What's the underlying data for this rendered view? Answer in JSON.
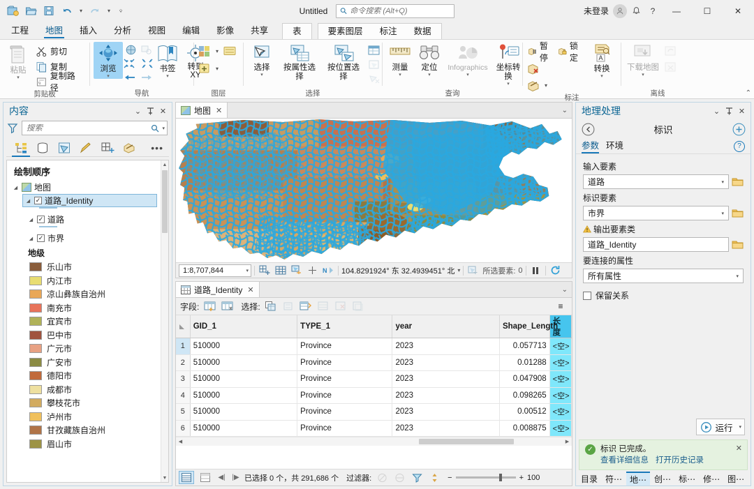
{
  "titlebar": {
    "doc_title": "Untitled",
    "search_placeholder": "命令搜索 (Alt+Q)",
    "account_status": "未登录",
    "quick_access": [
      "new-project-icon",
      "open-project-icon",
      "save-project-icon",
      "undo-icon",
      "redo-icon",
      "customize-qat-icon"
    ],
    "window_buttons": {
      "minimize": "—",
      "maximize": "☐",
      "close": "✕"
    },
    "help": "?"
  },
  "ribbon_tabs": {
    "items": [
      "工程",
      "地图",
      "插入",
      "分析",
      "视图",
      "编辑",
      "影像",
      "共享"
    ],
    "active": "地图",
    "contextual_single": [
      "表"
    ],
    "contextual_group": [
      "要素图层",
      "标注",
      "数据"
    ]
  },
  "ribbon": {
    "groups": [
      {
        "label": "剪贴板",
        "paste": "粘贴",
        "items": [
          "剪切",
          "复制",
          "复制路径"
        ]
      },
      {
        "label": "导航",
        "explore": "浏览",
        "bookmarks": "书签",
        "goto_xy_line1": "转到",
        "goto_xy_line2": "XY"
      },
      {
        "label": "图层"
      },
      {
        "label": "选择",
        "items": [
          "选择",
          "按属性选择",
          "按位置选择"
        ]
      },
      {
        "label": "查询",
        "items": [
          "测量",
          "定位",
          "Infographics",
          "坐标转换"
        ]
      },
      {
        "label": "标注",
        "pause": "暂停",
        "lock": "锁定",
        "convert": "转换"
      },
      {
        "label": "离线",
        "download_map": "下载地图"
      }
    ]
  },
  "contents_pane": {
    "title": "内容",
    "search_placeholder": "搜索",
    "draw_order_heading": "绘制顺序",
    "tabs": [
      "list-by-drawing-order-icon",
      "list-by-data-source-icon",
      "list-by-selection-icon",
      "list-by-editing-icon",
      "list-by-snapping-icon",
      "list-by-labeling-icon"
    ],
    "more": "•••",
    "tree": {
      "map_node": "地图",
      "layers": [
        {
          "name": "道路_Identity",
          "checked": true,
          "selected": true
        },
        {
          "name": "道路",
          "checked": true,
          "selected": false
        },
        {
          "name": "市界",
          "checked": true,
          "selected": false
        }
      ]
    },
    "legend": {
      "field": "地级",
      "items": [
        {
          "label": "乐山市",
          "color": "#8a5d3b"
        },
        {
          "label": "内江市",
          "color": "#e8dd72"
        },
        {
          "label": "凉山彝族自治州",
          "color": "#e9a757"
        },
        {
          "label": "南充市",
          "color": "#e8735a"
        },
        {
          "label": "宜宾市",
          "color": "#b0b258"
        },
        {
          "label": "巴中市",
          "color": "#a0533f"
        },
        {
          "label": "广元市",
          "color": "#e8a183"
        },
        {
          "label": "广安市",
          "color": "#8b8b43"
        },
        {
          "label": "德阳市",
          "color": "#c16a3b"
        },
        {
          "label": "成都市",
          "color": "#eee0a0"
        },
        {
          "label": "攀枝花市",
          "color": "#d2ab60"
        },
        {
          "label": "泸州市",
          "color": "#f0c05c"
        },
        {
          "label": "甘孜藏族自治州",
          "color": "#b07448"
        },
        {
          "label": "眉山市",
          "color": "#9d9345"
        }
      ]
    }
  },
  "map_view": {
    "tab_label": "地图",
    "close": "✕",
    "scale": "1:8,707,844",
    "coordinates": "104.8291924° 东  32.4939451° 北",
    "selected_features_label": "所选要素:",
    "selected_features_count": "0",
    "status_icons": [
      "add-grid-icon",
      "grid-icon",
      "selection-tool-icon",
      "crosshair-icon",
      "north-arrow-icon",
      "selected-features-icon",
      "pause-drawing-icon",
      "refresh-icon"
    ]
  },
  "attribute_table": {
    "tab_label": "道路_Identity",
    "close": "✕",
    "toolbar": {
      "fields_label": "字段:",
      "select_label": "选择:",
      "icons": [
        "add-field-icon",
        "calculate-field-icon",
        "select-all-icon",
        "switch-selection-icon",
        "clear-selection-icon",
        "delete-icon",
        "zoom-to-icon",
        "copy-rows-icon"
      ],
      "menu": "≡"
    },
    "columns": [
      "GID_1",
      "TYPE_1",
      "year",
      "Shape_Length",
      "长度"
    ],
    "highlighted_column": "长度",
    "rows": [
      {
        "n": "1",
        "GID_1": "510000",
        "TYPE_1": "Province",
        "year": "2023",
        "Shape_Length": "0.057713",
        "长度": "<空>"
      },
      {
        "n": "2",
        "GID_1": "510000",
        "TYPE_1": "Province",
        "year": "2023",
        "Shape_Length": "0.01288",
        "长度": "<空>"
      },
      {
        "n": "3",
        "GID_1": "510000",
        "TYPE_1": "Province",
        "year": "2023",
        "Shape_Length": "0.047908",
        "长度": "<空>"
      },
      {
        "n": "4",
        "GID_1": "510000",
        "TYPE_1": "Province",
        "year": "2023",
        "Shape_Length": "0.098265",
        "长度": "<空>"
      },
      {
        "n": "5",
        "GID_1": "510000",
        "TYPE_1": "Province",
        "year": "2023",
        "Shape_Length": "0.00512",
        "长度": "<空>"
      },
      {
        "n": "6",
        "GID_1": "510000",
        "TYPE_1": "Province",
        "year": "2023",
        "Shape_Length": "0.008875",
        "长度": "<空>"
      }
    ],
    "footer": {
      "status": "已选择 0 个，共 291,686 个",
      "filter_label": "过滤器:",
      "zoom_value": "100",
      "minus": "−",
      "plus": "+"
    }
  },
  "geoprocessing_pane": {
    "title": "地理处理",
    "tool_name": "标识",
    "tabs": [
      "参数",
      "环境"
    ],
    "active_tab": "参数",
    "help": "?",
    "fields": [
      {
        "label": "输入要素",
        "value": "道路",
        "type": "combo",
        "warn": false
      },
      {
        "label": "标识要素",
        "value": "市界",
        "type": "combo",
        "warn": false
      },
      {
        "label": "输出要素类",
        "value": "道路_Identity",
        "type": "text",
        "warn": true
      },
      {
        "label": "要连接的属性",
        "value": "所有属性",
        "type": "combo-nofolder",
        "warn": false
      }
    ],
    "checkbox": {
      "label": "保留关系",
      "checked": false
    },
    "run_button": "运行",
    "toast": {
      "message": "标识 已完成。",
      "link_details": "查看详细信息",
      "link_history": "打开历史记录",
      "close": "✕"
    },
    "bottom_tabs": [
      {
        "label": "目录",
        "active": false
      },
      {
        "label": "符⋯",
        "active": false
      },
      {
        "label": "地⋯",
        "active": true
      },
      {
        "label": "创⋯",
        "active": false
      },
      {
        "label": "标⋯",
        "active": false
      },
      {
        "label": "修⋯",
        "active": false
      },
      {
        "label": "图⋯",
        "active": false
      }
    ]
  },
  "colors": {
    "accent": "#1878b9",
    "pane_title": "#0b6593",
    "selection": "#cfe6f5",
    "highlight_col": "#46c5ee",
    "null_cell": "#7fe7fb",
    "toast_bg": "#e5f2e0",
    "road_cyan": "#29a8e0"
  }
}
